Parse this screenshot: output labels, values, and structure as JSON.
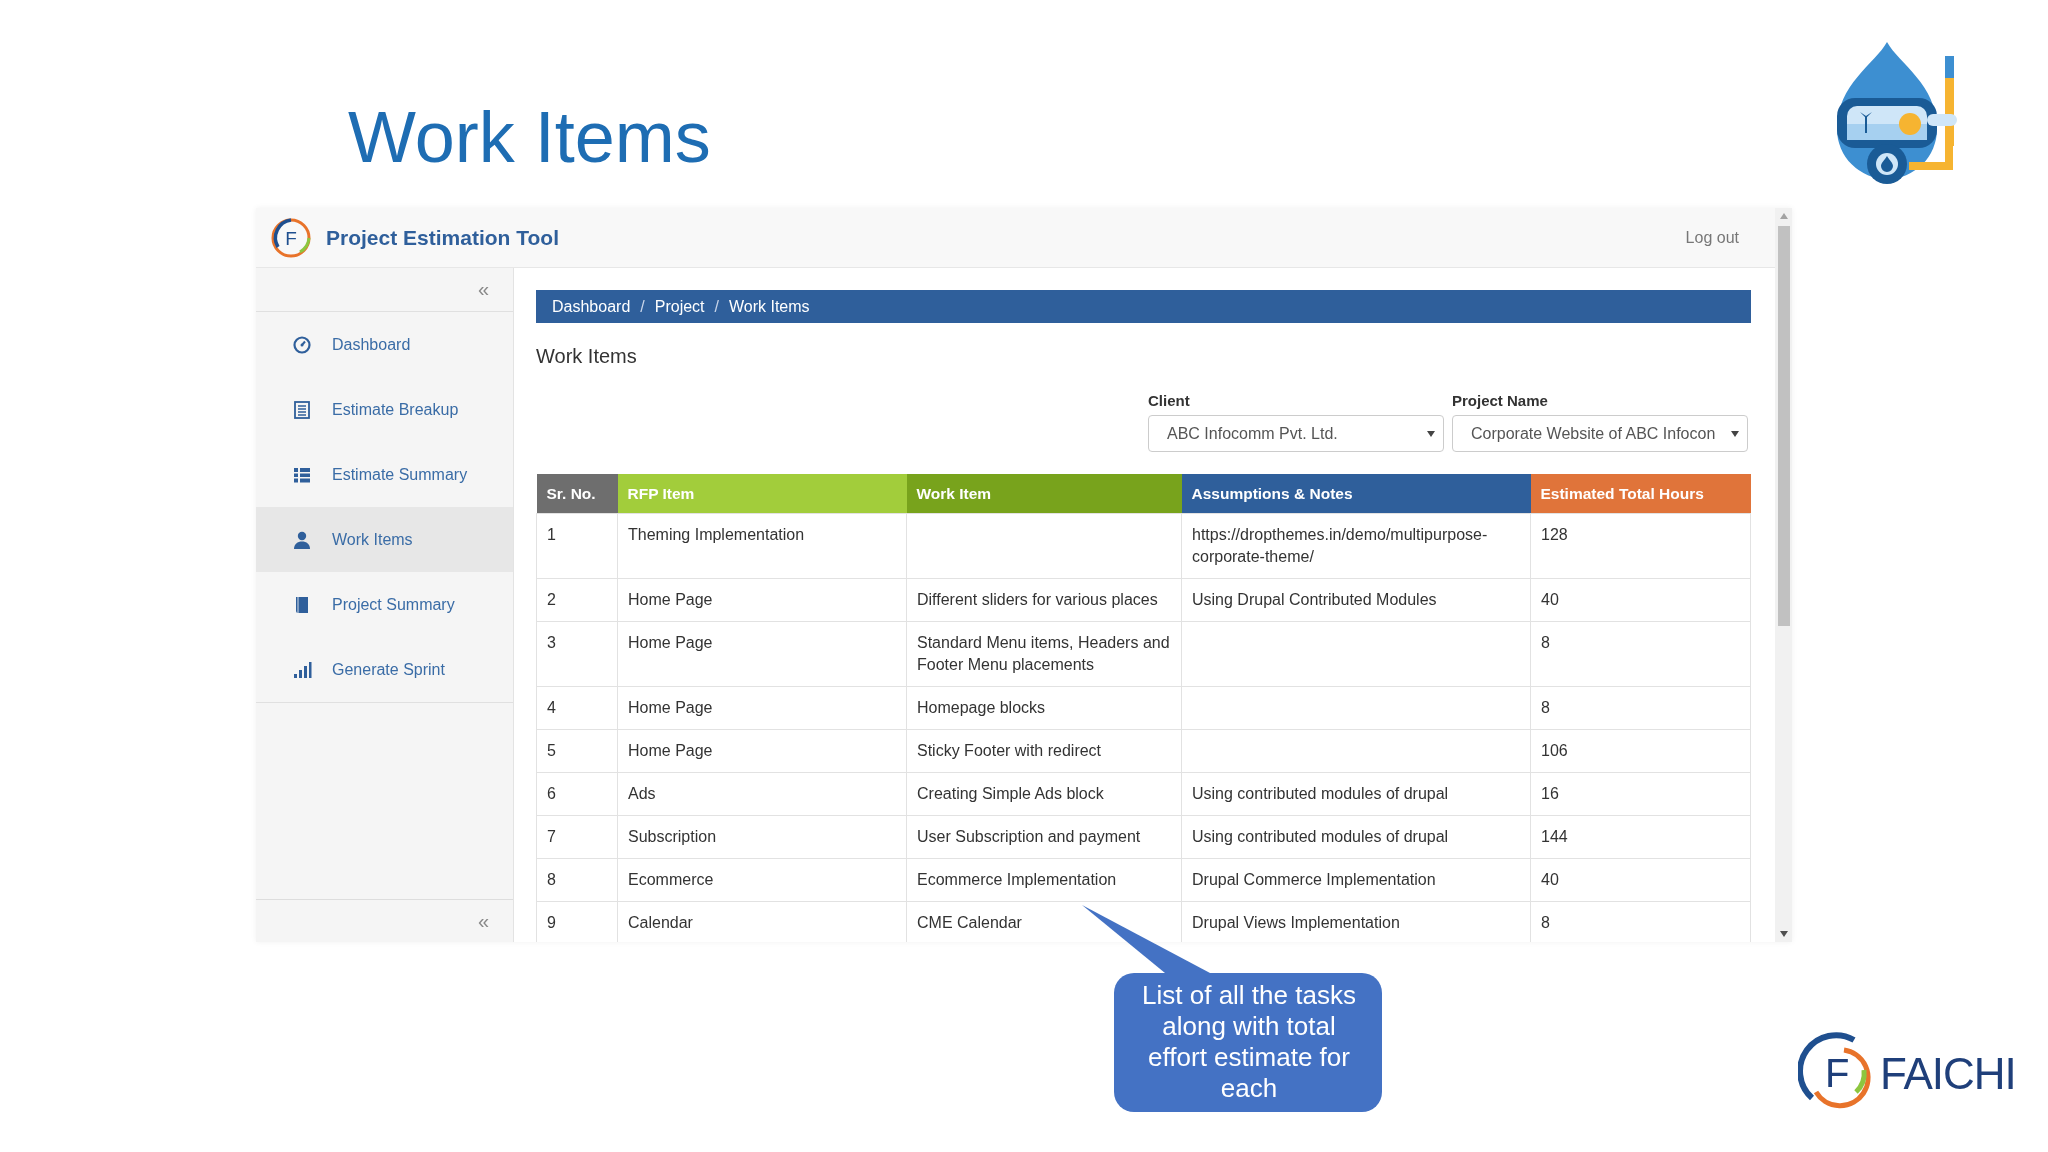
{
  "slide": {
    "title": "Work Items"
  },
  "app": {
    "logo_letter": "F",
    "title": "Project Estimation Tool",
    "logout": "Log out"
  },
  "sidebar": {
    "collapse": "«",
    "items": [
      {
        "label": "Dashboard",
        "selected": false
      },
      {
        "label": "Estimate Breakup",
        "selected": false
      },
      {
        "label": "Estimate Summary",
        "selected": false
      },
      {
        "label": "Work Items",
        "selected": true
      },
      {
        "label": "Project Summary",
        "selected": false
      },
      {
        "label": "Generate Sprint",
        "selected": false
      }
    ],
    "footer_collapse": "«"
  },
  "breadcrumb": {
    "separator": "/",
    "items": [
      "Dashboard",
      "Project",
      "Work Items"
    ]
  },
  "page_heading": "Work Items",
  "filters": [
    {
      "label": "Client",
      "value": "ABC Infocomm Pvt. Ltd."
    },
    {
      "label": "Project Name",
      "value": "Corporate Website of ABC Infocon"
    }
  ],
  "table": {
    "columns": [
      {
        "label": "Sr. No.",
        "color": "#6e6e6e"
      },
      {
        "label": "RFP Item",
        "color": "#a2cd3b"
      },
      {
        "label": "Work Item",
        "color": "#78a31c"
      },
      {
        "label": "Assumptions & Notes",
        "color": "#2f5f9b"
      },
      {
        "label": "Estimated Total Hours",
        "color": "#e0743a"
      }
    ],
    "rows": [
      [
        "1",
        "Theming Implementation",
        "",
        "https://dropthemes.in/demo/multipurpose-corporate-theme/",
        "128"
      ],
      [
        "2",
        "Home Page",
        "Different sliders for various places",
        "Using Drupal Contributed Modules",
        "40"
      ],
      [
        "3",
        "Home Page",
        "Standard Menu items, Headers and Footer Menu placements",
        "",
        "8"
      ],
      [
        "4",
        "Home Page",
        "Homepage blocks",
        "",
        "8"
      ],
      [
        "5",
        "Home Page",
        "Sticky Footer with redirect",
        "",
        "106"
      ],
      [
        "6",
        "Ads",
        "Creating Simple Ads block",
        "Using contributed modules of drupal",
        "16"
      ],
      [
        "7",
        "Subscription",
        "User Subscription and payment",
        "Using contributed modules of drupal",
        "144"
      ],
      [
        "8",
        "Ecommerce",
        "Ecommerce Implementation",
        "Drupal Commerce Implementation",
        "40"
      ],
      [
        "9",
        "Calendar",
        "CME Calendar",
        "Drupal Views Implementation",
        "8"
      ]
    ]
  },
  "callout": "List of all the tasks along with total effort estimate for each",
  "brand_logo": {
    "letter": "F",
    "name": "FAICHI"
  }
}
